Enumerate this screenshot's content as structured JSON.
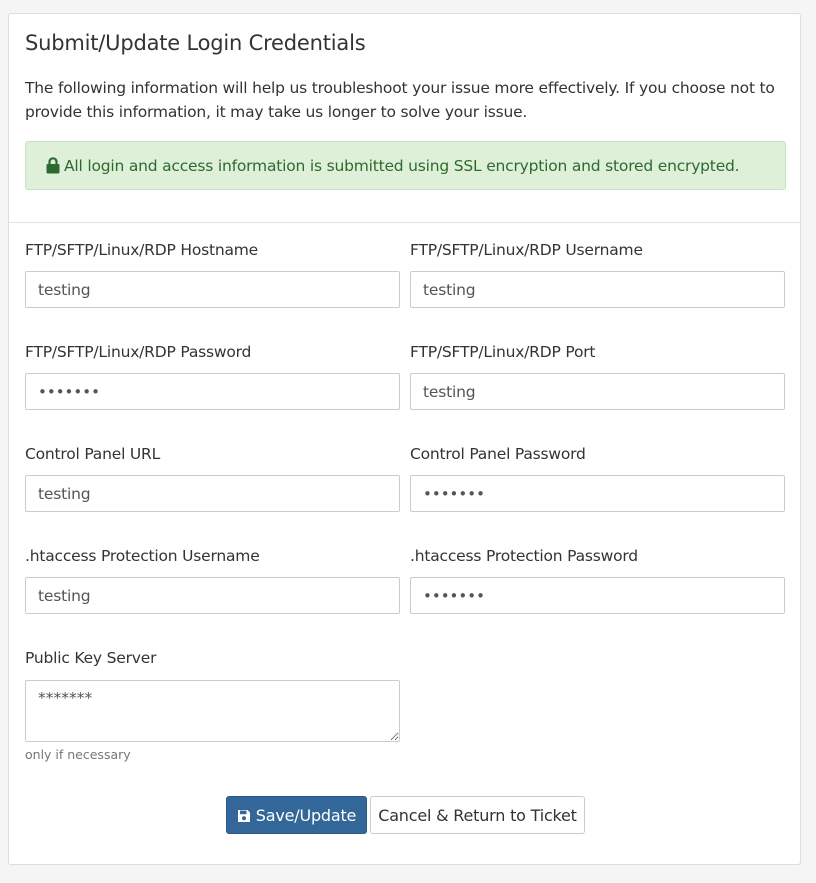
{
  "panel": {
    "title": "Submit/Update Login Credentials",
    "intro": "The following information will help us troubleshoot your issue more effectively. If you choose not to provide this information, it may take us longer to solve your issue.",
    "alert": "All login and access information is submitted using SSL encryption and stored encrypted."
  },
  "fields": {
    "ftp_hostname": {
      "label": "FTP/SFTP/Linux/RDP Hostname",
      "value": "testing"
    },
    "ftp_username": {
      "label": "FTP/SFTP/Linux/RDP Username",
      "value": "testing"
    },
    "ftp_password": {
      "label": "FTP/SFTP/Linux/RDP Password",
      "value": "•••••••"
    },
    "ftp_port": {
      "label": "FTP/SFTP/Linux/RDP Port",
      "value": "testing"
    },
    "cp_url": {
      "label": "Control Panel URL",
      "value": "testing"
    },
    "cp_password": {
      "label": "Control Panel Password",
      "value": "•••••••"
    },
    "ht_username": {
      "label": ".htaccess Protection Username",
      "value": "testing"
    },
    "ht_password": {
      "label": ".htaccess Protection Password",
      "value": "•••••••"
    },
    "public_key": {
      "label": "Public Key Server",
      "value": "*******",
      "help": "only if necessary"
    }
  },
  "buttons": {
    "save": "Save/Update",
    "cancel": "Cancel & Return to Ticket"
  },
  "colors": {
    "primary": "#336699",
    "alert_bg": "#dff0d8",
    "alert_text": "#2d6a2f"
  },
  "icons": {
    "alert": "lock-icon",
    "save": "floppy-disk-icon"
  }
}
